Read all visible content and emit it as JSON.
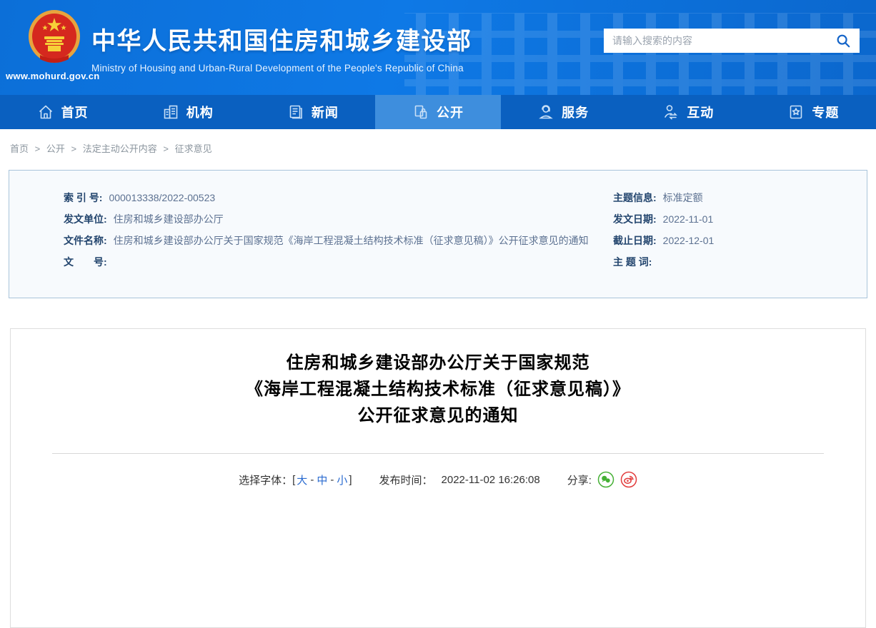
{
  "header": {
    "site_title": "中华人民共和国住房和城乡建设部",
    "site_subtitle": "Ministry of Housing and Urban-Rural Development of the People's Republic of China",
    "site_url": "www.mohurd.gov.cn",
    "search_placeholder": "请输入搜索的内容"
  },
  "nav": {
    "items": [
      {
        "label": "首页",
        "icon": "home-icon",
        "active": false
      },
      {
        "label": "机构",
        "icon": "organization-icon",
        "active": false
      },
      {
        "label": "新闻",
        "icon": "news-icon",
        "active": false
      },
      {
        "label": "公开",
        "icon": "disclosure-icon",
        "active": true
      },
      {
        "label": "服务",
        "icon": "service-icon",
        "active": false
      },
      {
        "label": "互动",
        "icon": "interaction-icon",
        "active": false
      },
      {
        "label": "专题",
        "icon": "topic-icon",
        "active": false
      }
    ]
  },
  "breadcrumb": {
    "separator": ">",
    "items": [
      "首页",
      "公开",
      "法定主动公开内容",
      "征求意见"
    ]
  },
  "metadata": {
    "left": [
      {
        "label": "索 引 号:",
        "value": "000013338/2022-00523"
      },
      {
        "label": "发文单位:",
        "value": "住房和城乡建设部办公厅"
      },
      {
        "label": "文件名称:",
        "value": "住房和城乡建设部办公厅关于国家规范《海岸工程混凝土结构技术标准（征求意见稿）》公开征求意见的通知"
      },
      {
        "label": "文　　号:",
        "value": ""
      }
    ],
    "right": [
      {
        "label": "主题信息:",
        "value": "标准定额"
      },
      {
        "label": "发文日期:",
        "value": "2022-11-01"
      },
      {
        "label": "截止日期:",
        "value": "2022-12-01"
      },
      {
        "label": "主 题 词:",
        "value": ""
      }
    ]
  },
  "article": {
    "title_line1": "住房和城乡建设部办公厅关于国家规范",
    "title_line2": "《海岸工程混凝土结构技术标准（征求意见稿）》",
    "title_line3": "公开征求意见的通知",
    "font_selector": {
      "label": "选择字体：",
      "bracket_open": "[",
      "size_large": "大",
      "size_medium": "中",
      "size_small": "小",
      "dash": "-",
      "bracket_close": "]"
    },
    "publish_label": "发布时间：",
    "publish_time": "2022-11-02 16:26:08",
    "share_label": "分享:"
  },
  "colors": {
    "header_blue": "#0d72dd",
    "nav_blue": "#0a60c0",
    "nav_active_blue": "#3e8edd",
    "link_blue": "#2a6bd0",
    "label_navy": "#23456e",
    "value_gray_blue": "#5c7191",
    "wechat_green": "#45b035",
    "weibo_red": "#e23c3c"
  }
}
